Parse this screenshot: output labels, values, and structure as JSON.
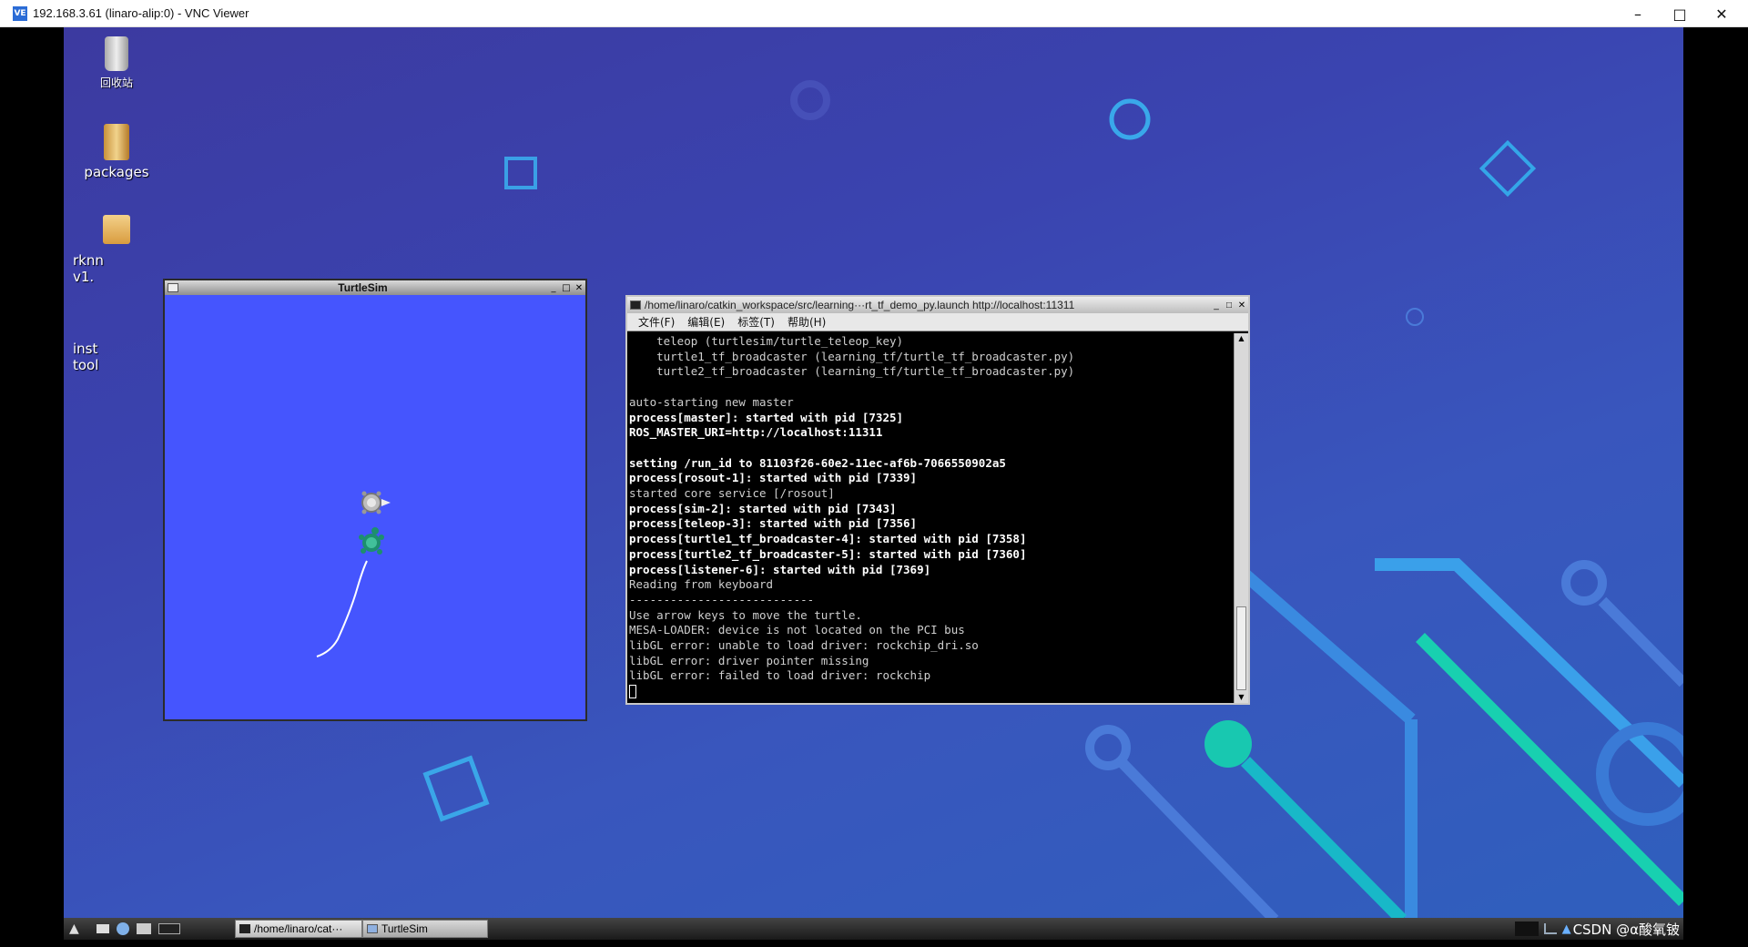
{
  "vnc": {
    "title": "192.168.3.61 (linaro-alip:0) - VNC Viewer",
    "logo": "VE"
  },
  "desktop_icons": [
    {
      "label": "回收站",
      "icon": "trash-icon"
    },
    {
      "label": "packages",
      "icon": "folder-icon"
    },
    {
      "label": "rknn\nv1.",
      "icon": "archive-icon"
    },
    {
      "label": "inst\ntool",
      "icon": "file-icon"
    }
  ],
  "turtlesim": {
    "title": "TurtleSim"
  },
  "terminal": {
    "title": "/home/linaro/catkin_workspace/src/learning···rt_tf_demo_py.launch http://localhost:11311",
    "menu": [
      "文件(F)",
      "编辑(E)",
      "标签(T)",
      "帮助(H)"
    ],
    "lines": [
      {
        "text": "    teleop (turtlesim/turtle_teleop_key)",
        "style": "dim"
      },
      {
        "text": "    turtle1_tf_broadcaster (learning_tf/turtle_tf_broadcaster.py)",
        "style": "dim"
      },
      {
        "text": "    turtle2_tf_broadcaster (learning_tf/turtle_tf_broadcaster.py)",
        "style": "dim"
      },
      {
        "text": "",
        "style": "dim"
      },
      {
        "text": "auto-starting new master",
        "style": "dim"
      },
      {
        "text": "process[master]: started with pid [7325]",
        "style": "b"
      },
      {
        "text": "ROS_MASTER_URI=http://localhost:11311",
        "style": "b"
      },
      {
        "text": "",
        "style": "dim"
      },
      {
        "text": "setting /run_id to 81103f26-60e2-11ec-af6b-7066550902a5",
        "style": "b"
      },
      {
        "text": "process[rosout-1]: started with pid [7339]",
        "style": "b"
      },
      {
        "text": "started core service [/rosout]",
        "style": "dim"
      },
      {
        "text": "process[sim-2]: started with pid [7343]",
        "style": "b"
      },
      {
        "text": "process[teleop-3]: started with pid [7356]",
        "style": "b"
      },
      {
        "text": "process[turtle1_tf_broadcaster-4]: started with pid [7358]",
        "style": "b"
      },
      {
        "text": "process[turtle2_tf_broadcaster-5]: started with pid [7360]",
        "style": "b"
      },
      {
        "text": "process[listener-6]: started with pid [7369]",
        "style": "b"
      },
      {
        "text": "Reading from keyboard",
        "style": "dim"
      },
      {
        "text": "---------------------------",
        "style": "dim"
      },
      {
        "text": "Use arrow keys to move the turtle.",
        "style": "dim"
      },
      {
        "text": "MESA-LOADER: device is not located on the PCI bus",
        "style": "dim"
      },
      {
        "text": "libGL error: unable to load driver: rockchip_dri.so",
        "style": "dim"
      },
      {
        "text": "libGL error: driver pointer missing",
        "style": "dim"
      },
      {
        "text": "libGL error: failed to load driver: rockchip",
        "style": "dim"
      }
    ]
  },
  "taskbar": {
    "tasks": [
      {
        "label": "/home/linaro/cat···",
        "icon": "terminal-icon"
      },
      {
        "label": "TurtleSim",
        "icon": "window-icon"
      }
    ],
    "tray_text": "CSDN @α酸氧铍"
  },
  "colors": {
    "turtle_bg": "#4555fe",
    "desktop": "#3a44b0",
    "accent_teal": "#18c8b0"
  }
}
